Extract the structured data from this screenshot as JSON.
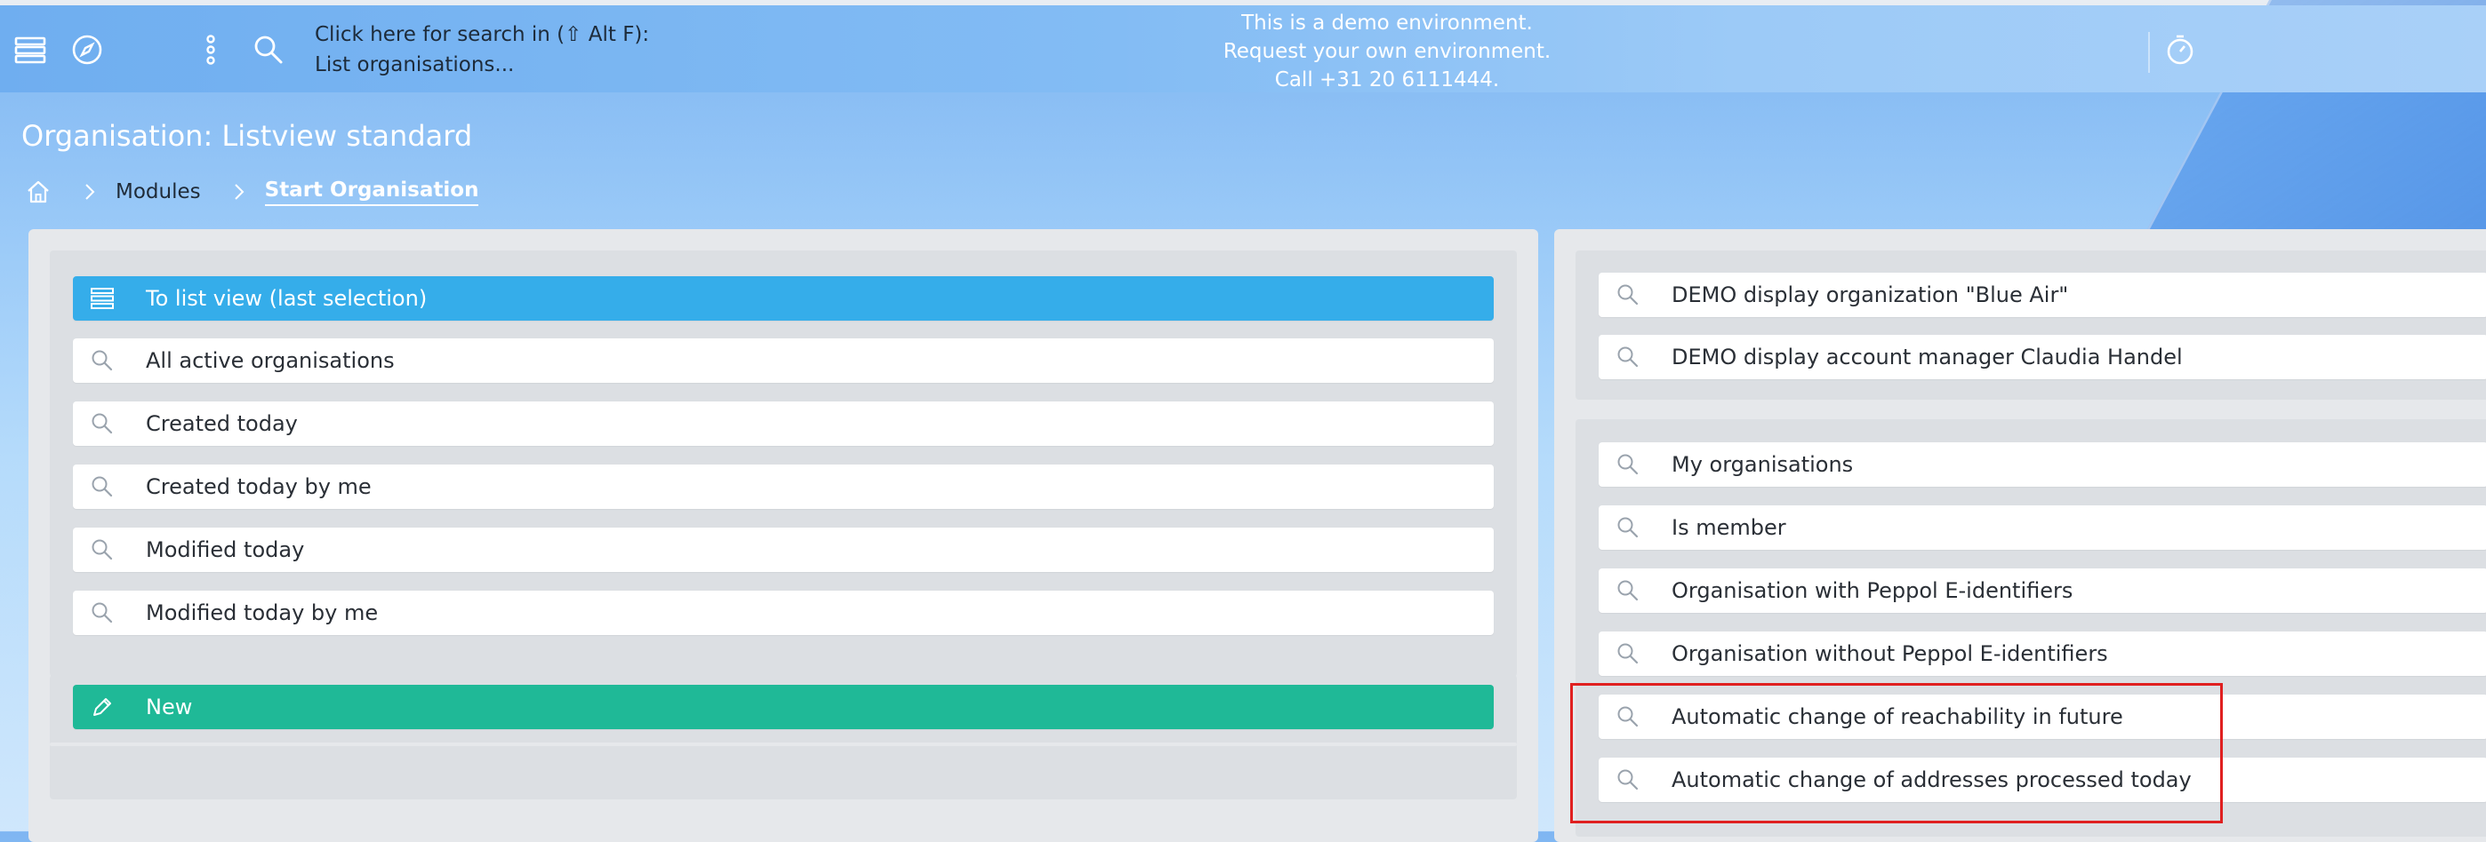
{
  "topbar": {
    "search_hint_line1": "Click here for search in (⇧ Alt F):",
    "search_hint_line2": "List organisations...",
    "demo_line1": "This is a demo environment.",
    "demo_line2": "Request your own environment.",
    "demo_line3": "Call +31 20 6111444.",
    "icons": [
      "menu-icon",
      "compass-icon",
      "more-vertical-icon",
      "search-icon",
      "timer-icon"
    ]
  },
  "page": {
    "title": "Organisation: Listview standard"
  },
  "breadcrumb": {
    "modules": "Modules",
    "current": "Start Organisation"
  },
  "left_panel": {
    "list_view": "To list view (last selection)",
    "items": [
      "All active organisations",
      "Created today",
      "Created today by me",
      "Modified today",
      "Modified today by me"
    ],
    "new_label": "New"
  },
  "right_panel": {
    "demo_items": [
      "DEMO display organization \"Blue Air\"",
      "DEMO display account manager Claudia Handel"
    ],
    "items": [
      "My organisations",
      "Is member",
      "Organisation with Peppol E-identifiers",
      "Organisation without Peppol E-identifiers",
      "Automatic change of reachability in future",
      "Automatic change of addresses processed today"
    ]
  },
  "colors": {
    "primary": "#35adea",
    "success": "#1fb997",
    "highlight": "#e02020"
  }
}
